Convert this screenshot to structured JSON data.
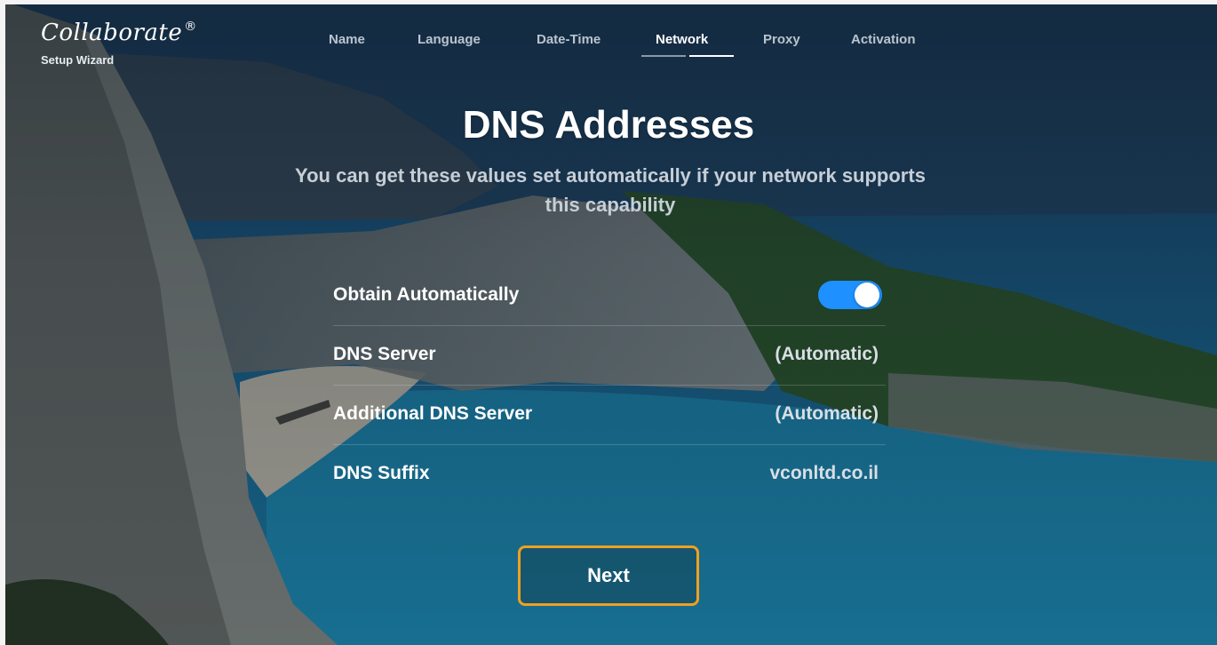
{
  "logo": {
    "brand": "Collaborate",
    "registered_mark": "®",
    "subtitle": "Setup Wizard"
  },
  "steps": [
    {
      "label": "Name",
      "active": false
    },
    {
      "label": "Language",
      "active": false
    },
    {
      "label": "Date-Time",
      "active": false
    },
    {
      "label": "Network",
      "active": true
    },
    {
      "label": "Proxy",
      "active": false
    },
    {
      "label": "Activation",
      "active": false
    }
  ],
  "page": {
    "title": "DNS Addresses",
    "subtitle": "You can get these values set automatically if your network supports this capability"
  },
  "settings": {
    "obtain_automatically": {
      "label": "Obtain Automatically",
      "enabled": true
    },
    "dns_server": {
      "label": "DNS Server",
      "value": "(Automatic)"
    },
    "additional_dns_server": {
      "label": "Additional DNS Server",
      "value": "(Automatic)"
    },
    "dns_suffix": {
      "label": "DNS Suffix",
      "value": "vconltd.co.il"
    }
  },
  "actions": {
    "next_label": "Next"
  },
  "colors": {
    "toggle_on": "#1e90ff",
    "next_border": "#f0a020",
    "text": "#ffffff"
  }
}
